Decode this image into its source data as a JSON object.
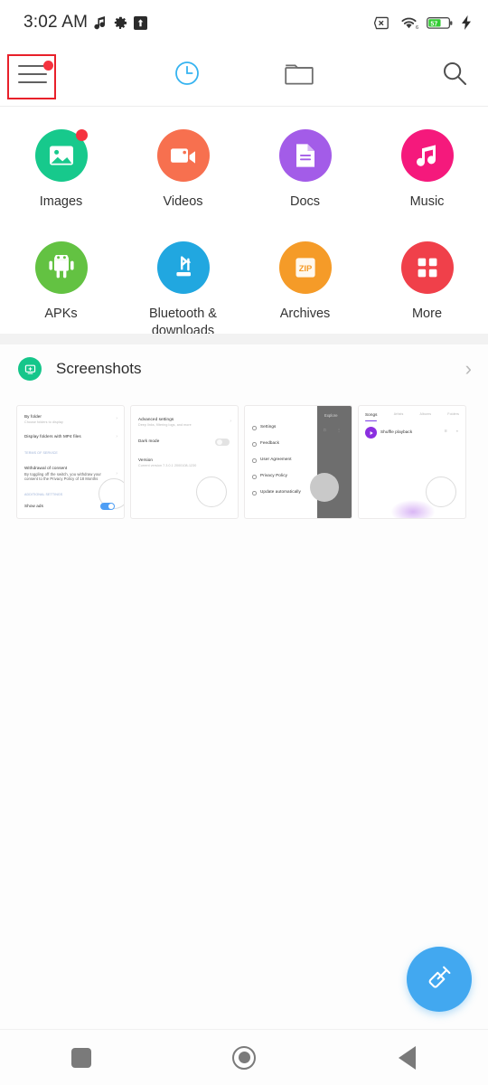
{
  "status_bar": {
    "clock": "3:02 AM",
    "left_icons": [
      {
        "name": "music-note-icon",
        "glyph": "♪"
      },
      {
        "name": "gear-icon",
        "glyph": "⚙"
      },
      {
        "name": "upload-arrow-icon",
        "glyph": "⬆"
      }
    ],
    "right_icons": [
      {
        "name": "sim-off-icon",
        "label": "x"
      },
      {
        "name": "wifi-icon",
        "label": "6"
      },
      {
        "name": "battery-icon",
        "level": "57"
      },
      {
        "name": "charging-bolt-icon",
        "glyph": "⚡"
      }
    ],
    "battery_percent": "57",
    "battery_color": "#33cc33"
  },
  "toolbar": {
    "items": [
      {
        "name": "menu-button",
        "label": "Menu",
        "icon": "hamburger-icon",
        "badge": true,
        "selected": true
      },
      {
        "name": "recent-button",
        "label": "Recent",
        "icon": "clock-icon",
        "active": true
      },
      {
        "name": "folders-button",
        "label": "Folders",
        "icon": "folder-icon",
        "active": false
      },
      {
        "name": "search-button",
        "label": "Search",
        "icon": "search-icon",
        "active": false
      }
    ],
    "active_color": "#35b3f0",
    "inactive_color": "#616161",
    "selection_color": "#e8202a"
  },
  "categories": [
    {
      "label": "Images",
      "icon": "image-icon",
      "color": "#17c98c",
      "badge": true
    },
    {
      "label": "Videos",
      "icon": "video-icon",
      "color": "#f7704f",
      "badge": false
    },
    {
      "label": "Docs",
      "icon": "document-icon",
      "color": "#a35ce8",
      "badge": false
    },
    {
      "label": "Music",
      "icon": "music-icon",
      "color": "#f5197c",
      "badge": false
    },
    {
      "label": "APKs",
      "icon": "android-icon",
      "color": "#60c martin",
      "badge": false
    },
    {
      "label": "Bluetooth &\ndownloads",
      "icon": "bluetooth-download-icon",
      "color": "#21a7e0",
      "badge": false
    },
    {
      "label": "Archives",
      "icon": "zip-icon",
      "color": "#f59b28",
      "badge": false
    },
    {
      "label": "More",
      "icon": "grid-icon",
      "color": "#f0404a",
      "badge": false
    }
  ],
  "category_colors": {
    "images": "#17c98c",
    "videos": "#f7704f",
    "docs": "#a35ce8",
    "music": "#f5197c",
    "apks": "#63c242",
    "bluetooth": "#21a7e0",
    "archives": "#f59b28",
    "more": "#f0404a"
  },
  "screenshots_section": {
    "title": "Screenshots",
    "icon": "screenshot-icon",
    "icon_color": "#15c68a",
    "chevron": "›",
    "thumbnails": [
      {
        "name": "thumbnail-folder-settings",
        "rows": [
          {
            "title": "By folder",
            "sub": "Choose folders to display"
          },
          {
            "title": "Display folders with MP4 files",
            "sub": ""
          },
          {
            "title": "TERMS OF SERVICE",
            "sub": ""
          },
          {
            "title": "Withdrawal of consent",
            "sub": "By toggling off the switch, you withdraw your consent to the Privacy Policy of 18 Months"
          },
          {
            "title": "ADDITIONAL SETTINGS",
            "sub": ""
          },
          {
            "title": "Show ads",
            "sub": ""
          }
        ],
        "toggle_on": true
      },
      {
        "name": "thumbnail-advanced-settings",
        "rows": [
          {
            "title": "Advanced settings",
            "sub": "Deep links, filtering logs, and more"
          },
          {
            "title": "Dark mode",
            "sub": ""
          },
          {
            "title": "Version",
            "sub": "Current version 7.3.0.1 2000108-1230"
          }
        ],
        "toggle_on": false
      },
      {
        "name": "thumbnail-menu-dark",
        "rows": [
          {
            "title": "Settings",
            "sub": ""
          },
          {
            "title": "Feedback",
            "sub": ""
          },
          {
            "title": "User Agreement",
            "sub": ""
          },
          {
            "title": "Privacy Policy",
            "sub": ""
          },
          {
            "title": "Update automatically",
            "sub": ""
          }
        ],
        "dark_panel": true,
        "dark_panel_label": "Explore"
      },
      {
        "name": "thumbnail-music-player",
        "tabs": [
          "Songs",
          "Artists",
          "Albums",
          "Folders"
        ],
        "rows": [
          {
            "title": "Shuffle playback",
            "sub": ""
          }
        ],
        "accent": "#8b2fe0"
      }
    ]
  },
  "fab": {
    "name": "cleaner-fab",
    "icon": "broom-icon",
    "color": "#42a8f0",
    "label": "Clean"
  },
  "nav_bar": {
    "items": [
      {
        "name": "recents-button",
        "icon": "square-icon",
        "label": "Recents"
      },
      {
        "name": "home-button",
        "icon": "circle-icon",
        "label": "Home"
      },
      {
        "name": "back-button",
        "icon": "triangle-icon",
        "label": "Back"
      }
    ],
    "color": "#7a7a7a"
  }
}
